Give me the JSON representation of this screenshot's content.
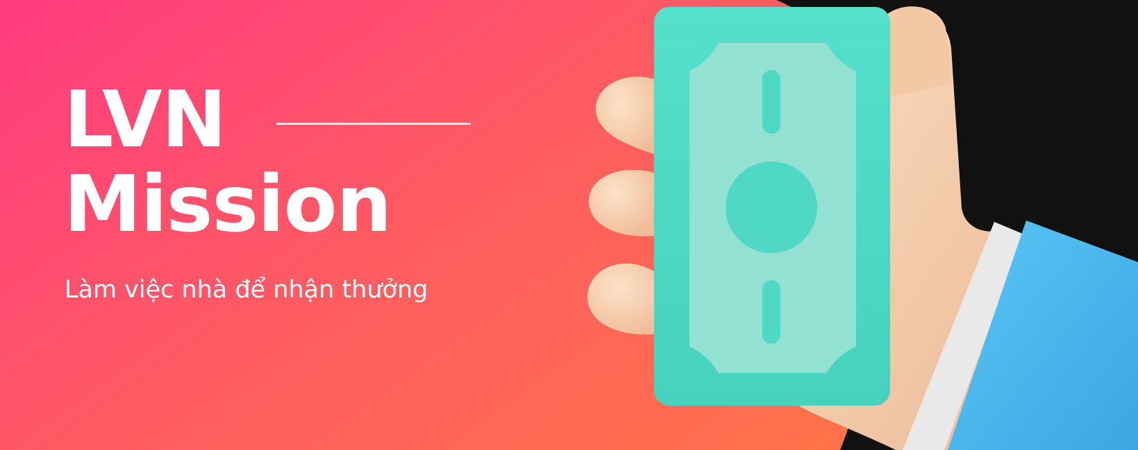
{
  "banner": {
    "title_line1": "LVN",
    "title_line2": "Mission",
    "subtitle": "Làm việc nhà để nhận thưởng"
  },
  "illustration": {
    "subject": "hand-holding-banknote",
    "icons": [
      "banknote-icon",
      "hand-icon",
      "sleeve-icon"
    ]
  },
  "colors": {
    "gradient_start": "#ff3d7f",
    "gradient_end": "#ff6e4a",
    "dark_corner": "#111111",
    "banknote": "#4fdcc6",
    "banknote_panel": "#92e0d2",
    "skin": "#f7cfae",
    "sleeve": "#4fb8ec",
    "cuff": "#eeeeee",
    "text": "#ffffff"
  }
}
